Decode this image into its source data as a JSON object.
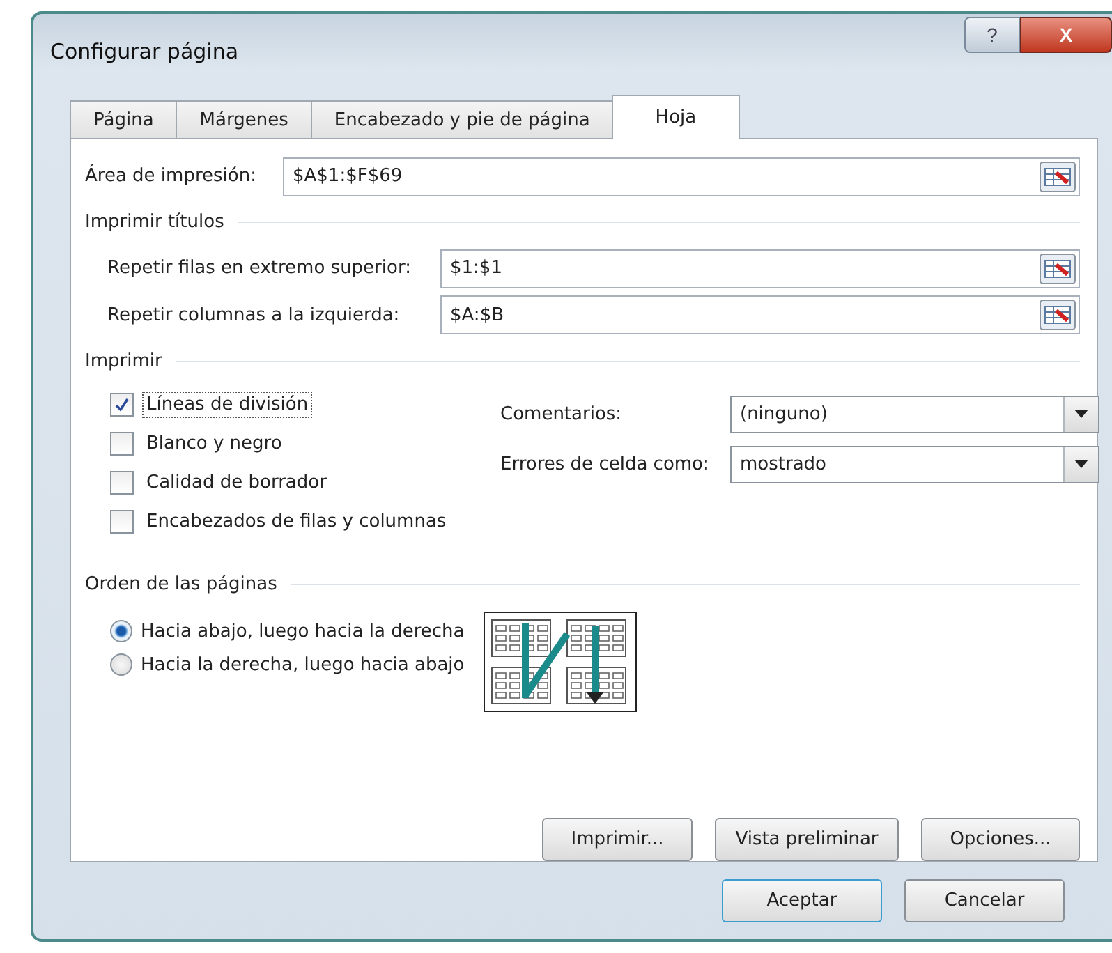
{
  "window": {
    "title": "Configurar página",
    "help": "?",
    "close": "X"
  },
  "tabs": [
    {
      "label": "Página",
      "selected": false
    },
    {
      "label": "Márgenes",
      "selected": false
    },
    {
      "label": "Encabezado y pie de página",
      "selected": false
    },
    {
      "label": "Hoja",
      "selected": true
    }
  ],
  "print_area": {
    "label": "Área de impresión:",
    "value": "$A$1:$F$69"
  },
  "print_titles": {
    "title": "Imprimir títulos",
    "fields": [
      {
        "label": "Repetir filas en extremo superior:",
        "value": "$1:$1"
      },
      {
        "label": "Repetir columnas a la izquierda:",
        "value": "$A:$B"
      }
    ]
  },
  "print": {
    "title": "Imprimir",
    "checkboxes": [
      {
        "label": "Líneas de división",
        "checked": true
      },
      {
        "label": "Blanco y negro",
        "checked": false
      },
      {
        "label": "Calidad de borrador",
        "checked": false
      },
      {
        "label": "Encabezados de filas y columnas",
        "checked": false
      }
    ],
    "dropdowns": [
      {
        "label": "Comentarios:",
        "value": "(ninguno)"
      },
      {
        "label": "Errores de celda como:",
        "value": "mostrado"
      }
    ]
  },
  "page_order": {
    "title": "Orden de las páginas",
    "options": [
      {
        "label": "Hacia abajo, luego hacia la derecha",
        "selected": true
      },
      {
        "label": "Hacia la derecha, luego hacia abajo",
        "selected": false
      }
    ]
  },
  "sheet_buttons": [
    "Imprimir...",
    "Vista preliminar",
    "Opciones..."
  ],
  "dialog_buttons": [
    "Aceptar",
    "Cancelar"
  ]
}
